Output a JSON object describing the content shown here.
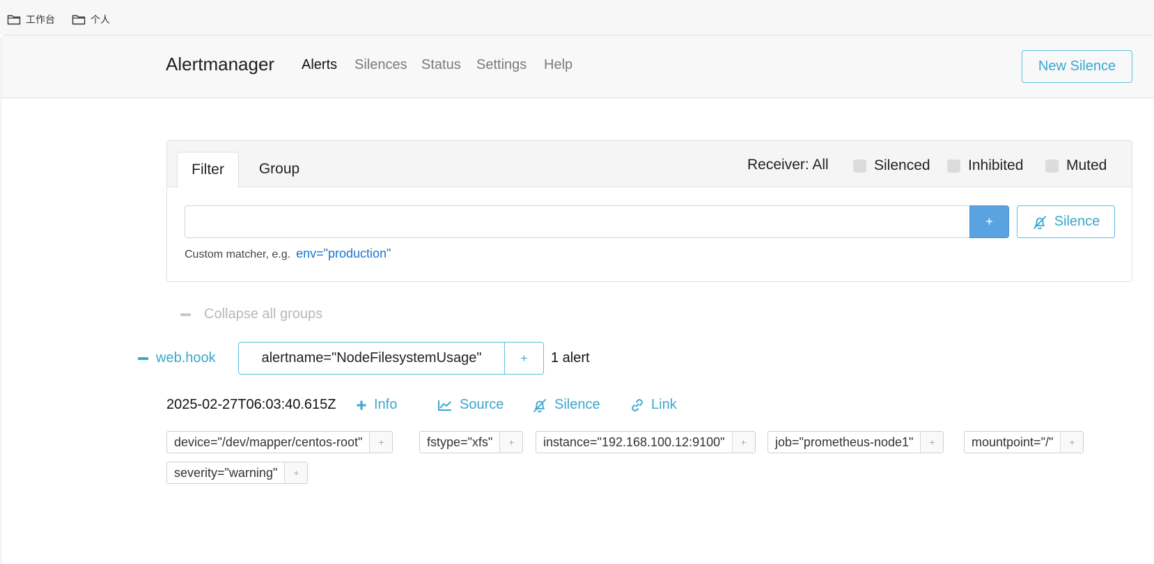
{
  "bookmarks": [
    {
      "label": "工作台",
      "icon": "folder-icon"
    },
    {
      "label": "个人",
      "icon": "folder-icon"
    }
  ],
  "navbar": {
    "brand": "Alertmanager",
    "links": [
      "Alerts",
      "Silences",
      "Status",
      "Settings",
      "Help"
    ],
    "active_link": "Alerts",
    "new_silence_label": "New Silence"
  },
  "filter_card": {
    "tabs": [
      "Filter",
      "Group"
    ],
    "active_tab": "Filter",
    "receiver_label": "Receiver: All",
    "checkboxes": [
      "Silenced",
      "Inhibited",
      "Muted"
    ],
    "matcher_input_value": "",
    "add_button_label": "+",
    "silence_button_label": "Silence",
    "hint_prefix": "Custom matcher, e.g.",
    "hint_example": "env=\"production\""
  },
  "collapse_all_label": "Collapse all groups",
  "group": {
    "receiver": "web.hook",
    "label": "alertname=\"NodeFilesystemUsage\"",
    "label_add": "+",
    "alert_count": "1 alert"
  },
  "alert": {
    "timestamp": "2025-02-27T06:03:40.615Z",
    "actions": [
      "Info",
      "Source",
      "Silence",
      "Link"
    ],
    "labels": [
      "device=\"/dev/mapper/centos-root\"",
      "fstype=\"xfs\"",
      "instance=\"192.168.100.12:9100\"",
      "job=\"prometheus-node1\"",
      "mountpoint=\"/\"",
      "severity=\"warning\""
    ],
    "label_add": "+"
  },
  "colors": {
    "accent": "#5bc0de",
    "link": "#3aa7cc",
    "primary_button": "#5aa2e0",
    "example_text": "#1a73d1"
  }
}
